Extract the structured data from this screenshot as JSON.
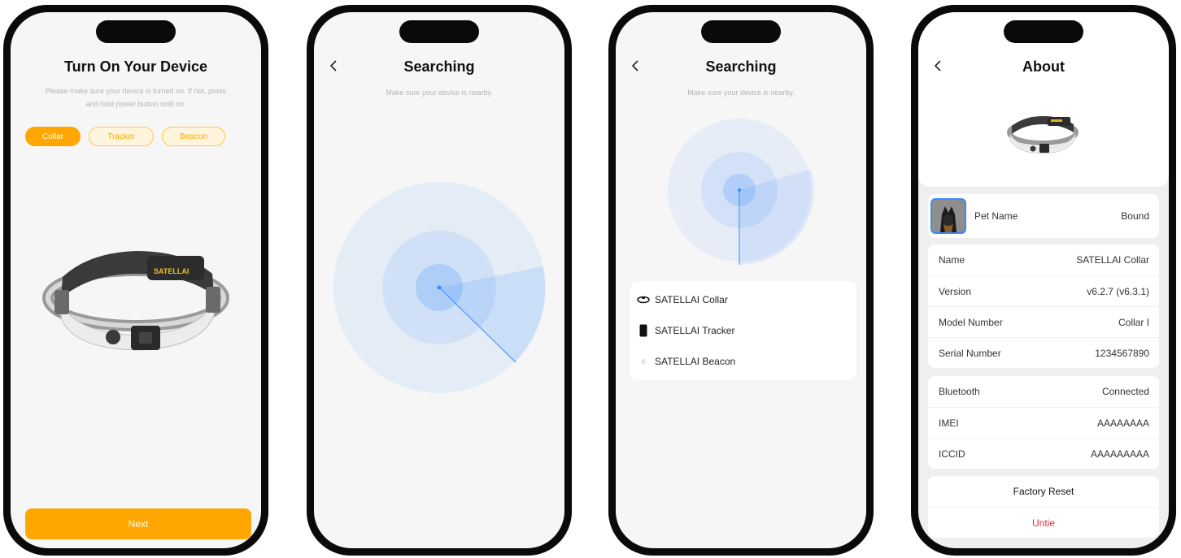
{
  "screen1": {
    "title": "Turn On Your Device",
    "subtitle_line1": "Please make sure your device is turned on. If not, press",
    "subtitle_line2": "and hold power button until on.",
    "chips": [
      "Collar",
      "Tracker",
      "Beacon"
    ],
    "selected_chip": "Collar",
    "product_label": "SATELLAI",
    "next_label": "Next"
  },
  "screen2": {
    "title": "Searching",
    "subtitle": "Make sure your device is nearby."
  },
  "screen3": {
    "title": "Searching",
    "subtitle": "Make sure your device is nearby.",
    "devices": [
      {
        "icon": "collar-icon",
        "label": "SATELLAI Collar"
      },
      {
        "icon": "tracker-icon",
        "label": "SATELLAI Tracker"
      },
      {
        "icon": "beacon-icon",
        "label": "SATELLAI Beacon"
      }
    ]
  },
  "screen4": {
    "title": "About",
    "pet": {
      "label": "Pet Name",
      "value": "Bound"
    },
    "info": [
      {
        "label": "Name",
        "value": "SATELLAI Collar"
      },
      {
        "label": "Version",
        "value": "v6.2.7 (v6.3.1)"
      },
      {
        "label": "Model Number",
        "value": "Collar I"
      },
      {
        "label": "Serial Number",
        "value": "1234567890"
      }
    ],
    "connection": [
      {
        "label": "Bluetooth",
        "value": "Connected"
      },
      {
        "label": "IMEI",
        "value": "AAAAAAAA"
      },
      {
        "label": "ICCID",
        "value": "AAAAAAAAA"
      }
    ],
    "factory_reset_label": "Factory Reset",
    "untie_label": "Untie"
  },
  "colors": {
    "accent": "#ffa600",
    "radar": "#3a8cff",
    "danger": "#f0283c"
  }
}
